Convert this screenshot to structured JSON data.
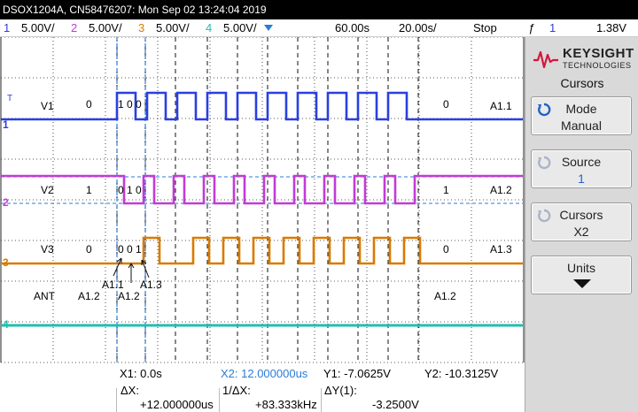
{
  "title_bar": "DSOX1204A, CN58476207: Mon Sep 02 13:24:04 2019",
  "channels": [
    {
      "num": "1",
      "scale": "5.00V/",
      "color": "#2a3fe0"
    },
    {
      "num": "2",
      "scale": "5.00V/",
      "color": "#c23bd6"
    },
    {
      "num": "3",
      "scale": "5.00V/",
      "color": "#d97a00"
    },
    {
      "num": "4",
      "scale": "5.00V/",
      "color": "#1fbfb0"
    }
  ],
  "timebase": {
    "delay": "60.00s",
    "scale": "20.00s/",
    "run_state": "Stop",
    "trigger_symbol": "ƒ",
    "trigger_channel": "1",
    "trigger_level": "1.38V"
  },
  "brand": {
    "name": "KEYSIGHT",
    "sub": "TECHNOLOGIES"
  },
  "softkeys": {
    "menu_title": "Cursors",
    "mode_label": "Mode",
    "mode_value": "Manual",
    "source_label": "Source",
    "source_value": "1",
    "cursors_label": "Cursors",
    "cursors_value": "X2",
    "units_label": "Units"
  },
  "readout": {
    "x1": "X1:  0.0s",
    "x2": "X2:  12.000000us",
    "y1": "Y1: -7.0625V",
    "y2": "Y2: -10.3125V",
    "dx_label": "ΔX:",
    "dx_value": "+12.000000us",
    "inv_dx_label": "1/ΔX:",
    "inv_dx_value": "+83.333kHz",
    "dy_label": "ΔY(1):",
    "dy_value": "-3.2500V"
  },
  "annotations": {
    "v1": "V1",
    "v1_left": "0",
    "v1_bits": "1 0 0",
    "v1_right": "0",
    "v1_tag": "A1.1",
    "v2": "V2",
    "v2_left": "1",
    "v2_bits": "0 1 0",
    "v2_right": "1",
    "v2_tag": "A1.2",
    "v3": "V3",
    "v3_left": "0",
    "v3_bits": "0 0 1",
    "v3_right": "0",
    "v3_tag": "A1.3",
    "ant": "ANT",
    "ant_left": "A1.2",
    "ant_mid": "A1.2",
    "ant_right": "A1.2",
    "arrow_a11": "A1.1",
    "arrow_a13": "A1.3",
    "marker_1": "1",
    "marker_2": "2",
    "marker_3": "3",
    "marker_4": "4",
    "marker_t": "T"
  },
  "colors": {
    "ch1": "#2a3fe0",
    "ch2": "#c23bd6",
    "ch3": "#d97a00",
    "ch4": "#1fbfb0",
    "cursor": "#2a7bd8"
  }
}
